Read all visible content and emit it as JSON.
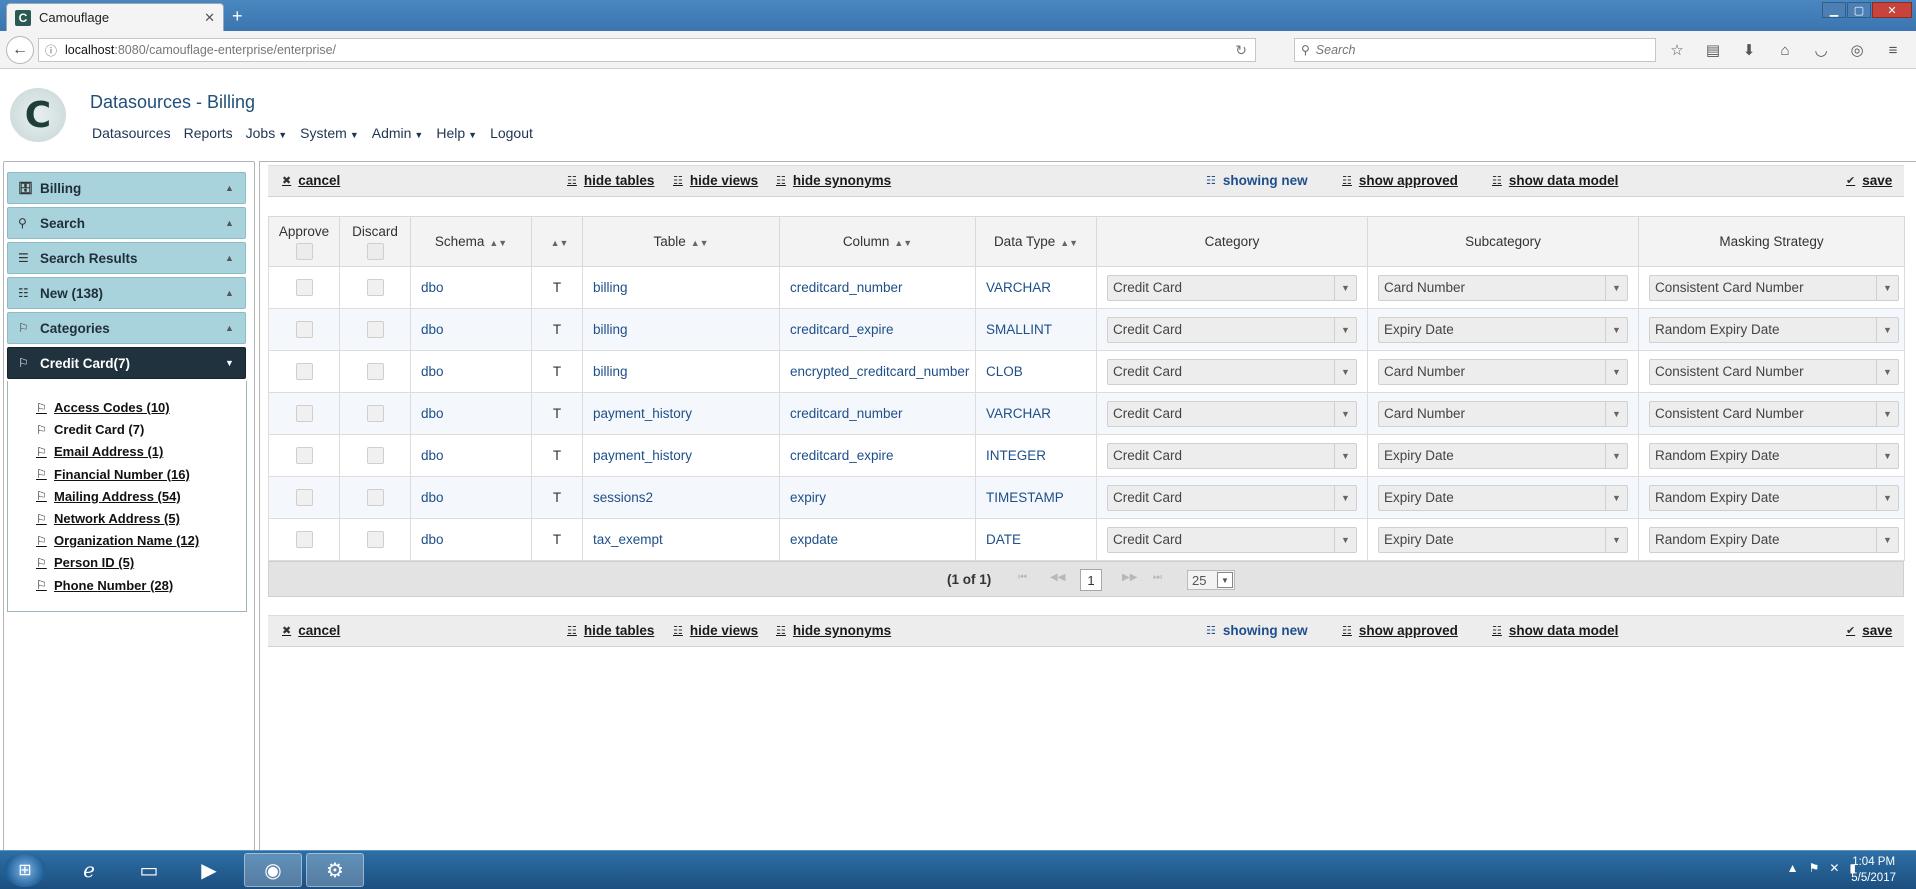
{
  "browser": {
    "tab_title": "Camouflage",
    "tab_favicon": "C",
    "url_host": "localhost",
    "url_path": ":8080/camouflage-enterprise/enterprise/",
    "search_placeholder": "Search"
  },
  "app": {
    "logo_letter": "C",
    "page_title": "Datasources - Billing",
    "nav": [
      {
        "label": "Datasources",
        "has_menu": false
      },
      {
        "label": "Reports",
        "has_menu": false
      },
      {
        "label": "Jobs",
        "has_menu": true
      },
      {
        "label": "System",
        "has_menu": true
      },
      {
        "label": "Admin",
        "has_menu": true
      },
      {
        "label": "Help",
        "has_menu": true
      },
      {
        "label": "Logout",
        "has_menu": false
      }
    ]
  },
  "sidebar": {
    "panels": [
      {
        "label": "Billing",
        "icon": "database-icon"
      },
      {
        "label": "Search",
        "icon": "search-icon"
      },
      {
        "label": "Search Results",
        "icon": "list-icon"
      },
      {
        "label": "New (138)",
        "icon": "new-list-icon"
      },
      {
        "label": "Categories",
        "icon": "tags-icon"
      },
      {
        "label": "Credit Card(7)",
        "icon": "tag-icon",
        "active": true
      }
    ],
    "categories": [
      "Access Codes (10)",
      "Credit Card (7)",
      "Email Address (1)",
      "Financial Number (16)",
      "Mailing Address (54)",
      "Network Address (5)",
      "Organization Name (12)",
      "Person ID (5)",
      "Phone Number (28)"
    ],
    "current_category_index": 1
  },
  "toolbar": {
    "cancel": "cancel",
    "hide_tables": "hide tables",
    "hide_views": "hide views",
    "hide_synonyms": "hide synonyms",
    "showing_new": "showing new",
    "show_approved": "show approved",
    "show_data_model": "show data model",
    "save": "save"
  },
  "table": {
    "headers": {
      "approve": "Approve",
      "discard": "Discard",
      "schema": "Schema",
      "type": "",
      "table": "Table",
      "column": "Column",
      "data_type": "Data Type",
      "category": "Category",
      "subcategory": "Subcategory",
      "masking": "Masking Strategy"
    },
    "rows": [
      {
        "schema": "dbo",
        "type": "T",
        "table": "billing",
        "column": "creditcard_number",
        "data_type": "VARCHAR",
        "category": "Credit Card",
        "subcategory": "Card Number",
        "masking": "Consistent Card Number"
      },
      {
        "schema": "dbo",
        "type": "T",
        "table": "billing",
        "column": "creditcard_expire",
        "data_type": "SMALLINT",
        "category": "Credit Card",
        "subcategory": "Expiry Date",
        "masking": "Random Expiry Date"
      },
      {
        "schema": "dbo",
        "type": "T",
        "table": "billing",
        "column": "encrypted_creditcard_number",
        "data_type": "CLOB",
        "category": "Credit Card",
        "subcategory": "Card Number",
        "masking": "Consistent Card Number"
      },
      {
        "schema": "dbo",
        "type": "T",
        "table": "payment_history",
        "column": "creditcard_number",
        "data_type": "VARCHAR",
        "category": "Credit Card",
        "subcategory": "Card Number",
        "masking": "Consistent Card Number"
      },
      {
        "schema": "dbo",
        "type": "T",
        "table": "payment_history",
        "column": "creditcard_expire",
        "data_type": "INTEGER",
        "category": "Credit Card",
        "subcategory": "Expiry Date",
        "masking": "Random Expiry Date"
      },
      {
        "schema": "dbo",
        "type": "T",
        "table": "sessions2",
        "column": "expiry",
        "data_type": "TIMESTAMP",
        "category": "Credit Card",
        "subcategory": "Expiry Date",
        "masking": "Random Expiry Date"
      },
      {
        "schema": "dbo",
        "type": "T",
        "table": "tax_exempt",
        "column": "expdate",
        "data_type": "DATE",
        "category": "Credit Card",
        "subcategory": "Expiry Date",
        "masking": "Random Expiry Date"
      }
    ]
  },
  "paginator": {
    "current": "(1 of 1)",
    "page": "1",
    "rows_per_page": "25"
  },
  "taskbar": {
    "time": "1:04 PM",
    "date": "5/5/2017"
  },
  "colors": {
    "accordion": "#a9d3dc",
    "accordion_active": "#21323f",
    "link_blue": "#1e4f8a",
    "taskbar": "#1c4f80"
  }
}
